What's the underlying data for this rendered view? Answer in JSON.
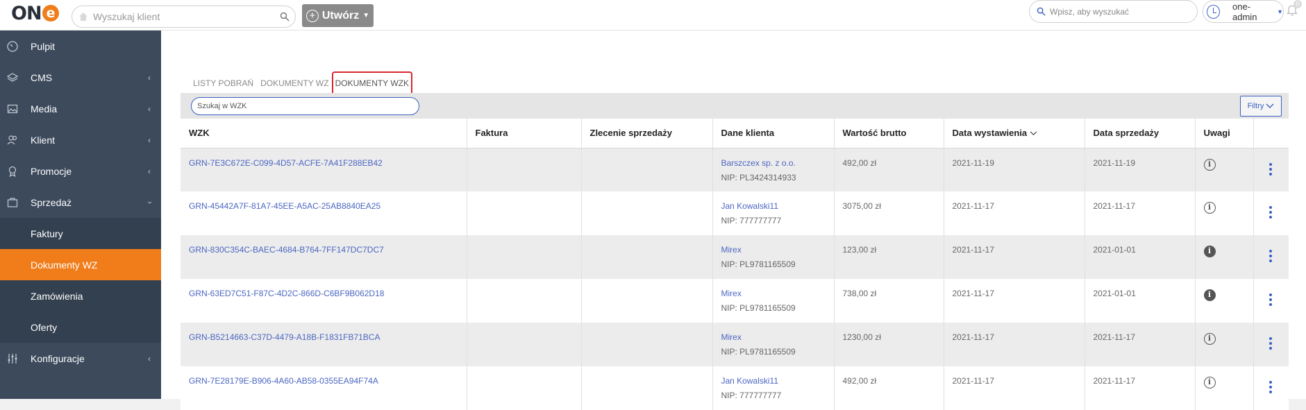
{
  "header": {
    "logo": "ONe",
    "client_search_placeholder": "Wyszukaj klient",
    "create_label": "Utwórz",
    "global_search_placeholder": "Wpisz, aby wyszukać",
    "user_name": "one-admin",
    "notification_count": "0"
  },
  "sidebar": {
    "items": [
      {
        "label": "Pulpit",
        "icon": "dashboard-icon"
      },
      {
        "label": "CMS",
        "icon": "layers-icon"
      },
      {
        "label": "Media",
        "icon": "image-icon"
      },
      {
        "label": "Klient",
        "icon": "users-icon"
      },
      {
        "label": "Promocje",
        "icon": "award-icon"
      },
      {
        "label": "Sprzedaż",
        "icon": "cart-icon"
      },
      {
        "label": "Konfiguracje",
        "icon": "sliders-icon"
      }
    ],
    "sub_items": [
      "Faktury",
      "Dokumenty WZ",
      "Zamówienia",
      "Oferty"
    ]
  },
  "tabs": [
    "LISTY POBRAŃ",
    "DOKUMENTY WZ",
    "DOKUMENTY WZK"
  ],
  "search_placeholder": "Szukaj w WZK",
  "filter_label": "Filtry",
  "table": {
    "columns": [
      "WZK",
      "Faktura",
      "Zlecenie sprzedaży",
      "Dane klienta",
      "Wartość brutto",
      "Data wystawienia",
      "Data sprzedaży",
      "Uwagi"
    ],
    "rows": [
      {
        "wzk": "GRN-7E3C672E-C099-4D57-ACFE-7A41F288EB42",
        "faktura": "",
        "zlecenie": "",
        "klient": "Barszczex sp. z o.o.",
        "nip": "NIP: PL3424314933",
        "wartosc": "492,00 zł",
        "data_wyst": "2021-11-19",
        "data_sprz": "2021-11-19",
        "uwagi_filled": false
      },
      {
        "wzk": "GRN-45442A7F-81A7-45EE-A5AC-25AB8840EA25",
        "faktura": "",
        "zlecenie": "",
        "klient": "Jan Kowalski11",
        "nip": "NIP: 777777777",
        "wartosc": "3075,00 zł",
        "data_wyst": "2021-11-17",
        "data_sprz": "2021-11-17",
        "uwagi_filled": false
      },
      {
        "wzk": "GRN-830C354C-BAEC-4684-B764-7FF147DC7DC7",
        "faktura": "",
        "zlecenie": "",
        "klient": "Mirex",
        "nip": "NIP: PL9781165509",
        "wartosc": "123,00 zł",
        "data_wyst": "2021-11-17",
        "data_sprz": "2021-01-01",
        "uwagi_filled": true
      },
      {
        "wzk": "GRN-63ED7C51-F87C-4D2C-866D-C6BF9B062D18",
        "faktura": "",
        "zlecenie": "",
        "klient": "Mirex",
        "nip": "NIP: PL9781165509",
        "wartosc": "738,00 zł",
        "data_wyst": "2021-11-17",
        "data_sprz": "2021-01-01",
        "uwagi_filled": true
      },
      {
        "wzk": "GRN-B5214663-C37D-4479-A18B-F1831FB71BCA",
        "faktura": "",
        "zlecenie": "",
        "klient": "Mirex",
        "nip": "NIP: PL9781165509",
        "wartosc": "1230,00 zł",
        "data_wyst": "2021-11-17",
        "data_sprz": "2021-11-17",
        "uwagi_filled": false
      },
      {
        "wzk": "GRN-7E28179E-B906-4A60-AB58-0355EA94F74A",
        "faktura": "",
        "zlecenie": "",
        "klient": "Jan Kowalski11",
        "nip": "NIP: 777777777",
        "wartosc": "492,00 zł",
        "data_wyst": "2021-11-17",
        "data_sprz": "2021-11-17",
        "uwagi_filled": false
      }
    ]
  },
  "colors": {
    "accent": "#f07c1a",
    "sidebar": "#3c4a5c",
    "link": "#4b66c2",
    "highlight": "#d9262c"
  }
}
